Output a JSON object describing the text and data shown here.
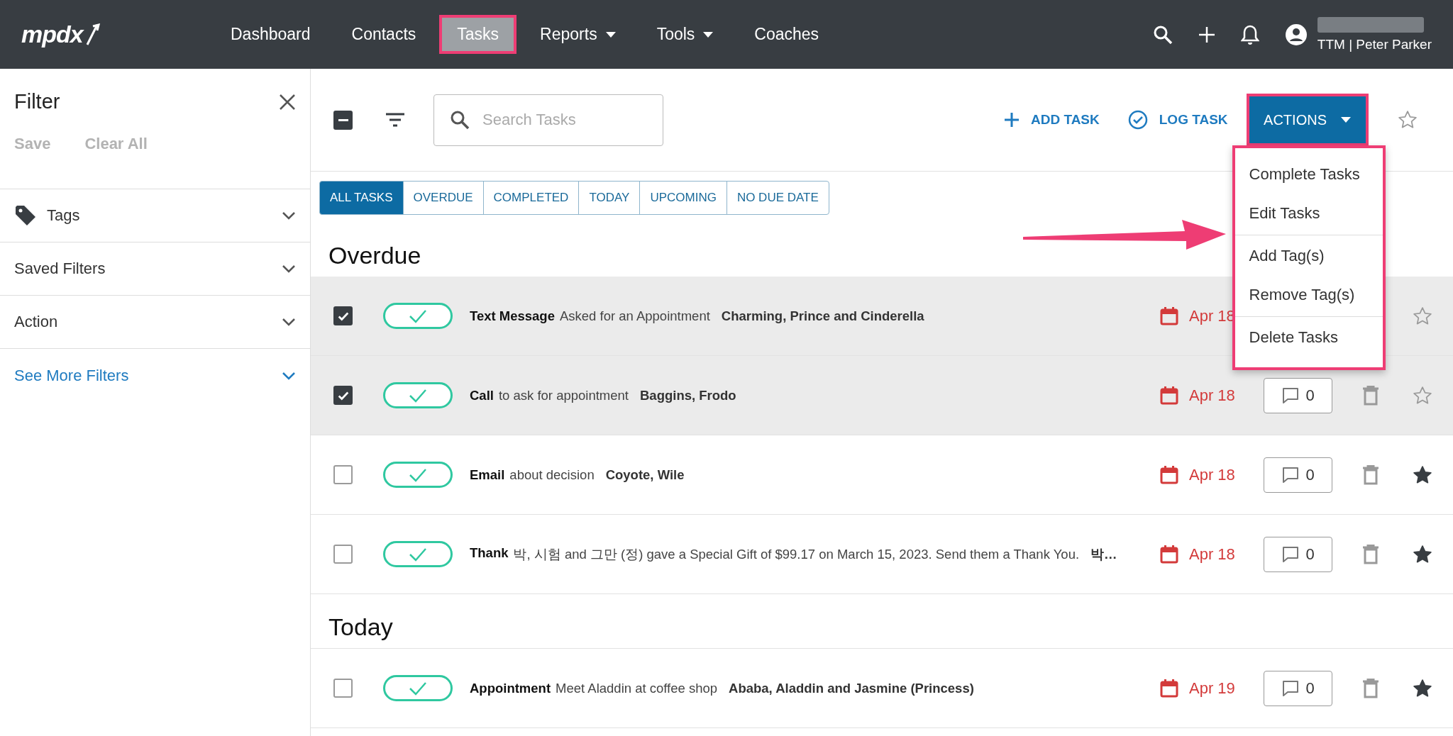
{
  "nav": {
    "logo": "mpdx",
    "items": [
      {
        "label": "Dashboard",
        "selected": false,
        "dropdown": false,
        "highlighted": false
      },
      {
        "label": "Contacts",
        "selected": false,
        "dropdown": false,
        "highlighted": false
      },
      {
        "label": "Tasks",
        "selected": true,
        "dropdown": false,
        "highlighted": true
      },
      {
        "label": "Reports",
        "selected": false,
        "dropdown": true,
        "highlighted": false
      },
      {
        "label": "Tools",
        "selected": false,
        "dropdown": true,
        "highlighted": false
      },
      {
        "label": "Coaches",
        "selected": false,
        "dropdown": false,
        "highlighted": false
      }
    ],
    "user": "TTM | Peter Parker"
  },
  "filter": {
    "title": "Filter",
    "actions": [
      "Save",
      "Clear All"
    ],
    "sections": [
      {
        "label": "Tags",
        "kind": "tag"
      },
      {
        "label": "Saved Filters",
        "kind": "plain"
      },
      {
        "label": "Action",
        "kind": "plain"
      },
      {
        "label": "See More Filters",
        "kind": "link"
      }
    ]
  },
  "toolbar": {
    "select_all": {
      "indeterminate": true
    },
    "search": {
      "placeholder": "Search Tasks"
    },
    "add_task": "ADD TASK",
    "log_task": "LOG TASK",
    "actions": {
      "label": "ACTIONS",
      "expanded": true,
      "highlighted": true,
      "menu": [
        [
          "Complete Tasks",
          "Edit Tasks"
        ],
        [
          "Add Tag(s)",
          "Remove Tag(s)"
        ],
        [
          "Delete Tasks"
        ]
      ]
    },
    "starred": false
  },
  "tabs": [
    {
      "label": "ALL TASKS",
      "selected": true
    },
    {
      "label": "OVERDUE",
      "selected": false
    },
    {
      "label": "COMPLETED",
      "selected": false
    },
    {
      "label": "TODAY",
      "selected": false
    },
    {
      "label": "UPCOMING",
      "selected": false
    },
    {
      "label": "NO DUE DATE",
      "selected": false
    }
  ],
  "groups": [
    {
      "title": "Overdue",
      "tasks": [
        {
          "checked": true,
          "type": "Text Message",
          "subject": "Asked for an Appointment",
          "contact": "Charming, Prince and Cinderella",
          "date": "Apr 18",
          "starred": false
        },
        {
          "checked": true,
          "type": "Call",
          "subject": "to ask for appointment",
          "contact": "Baggins, Frodo",
          "date": "Apr 18",
          "comments": "0",
          "starred": false
        },
        {
          "checked": false,
          "type": "Email",
          "subject": "about decision",
          "contact": "Coyote, Wile",
          "date": "Apr 18",
          "comments": "0",
          "starred": true
        },
        {
          "checked": false,
          "type": "Thank",
          "subject": "박, 시험 and 그만 (정) gave a Special Gift of $99.17 on March 15, 2023. Send them a Thank You.",
          "contact": "박…",
          "date": "Apr 18",
          "comments": "0",
          "starred": true
        }
      ]
    },
    {
      "title": "Today",
      "tasks": [
        {
          "checked": false,
          "type": "Appointment",
          "subject": "Meet Aladdin at coffee shop",
          "contact": "Ababa, Aladdin and Jasmine (Princess)",
          "date": "Apr 19",
          "comments": "0",
          "starred": true
        }
      ]
    }
  ]
}
